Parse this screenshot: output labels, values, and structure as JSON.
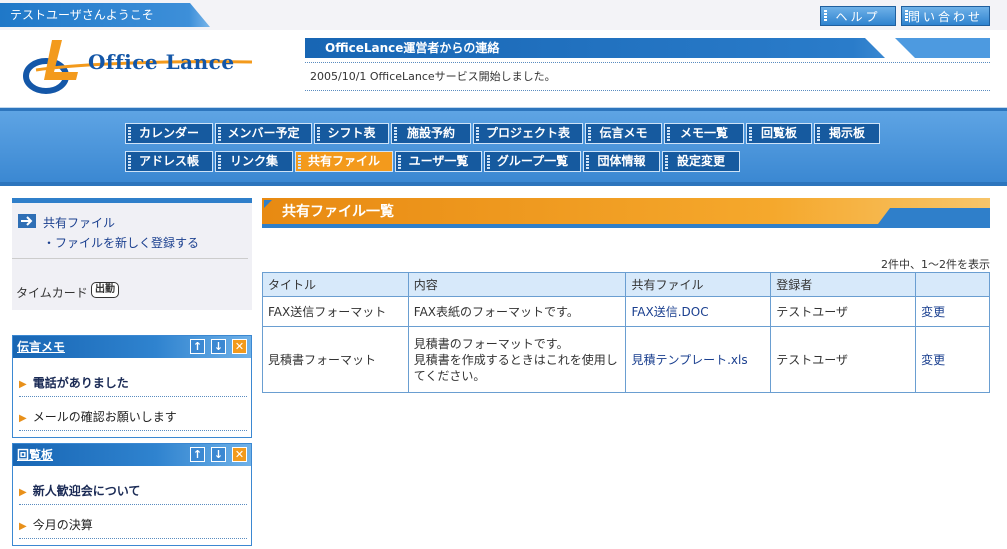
{
  "topbar": {
    "welcome": "テストユーザさんようこそ",
    "help_label": "ヘルプ",
    "contact_label": "問い合わせ"
  },
  "header": {
    "logo_text": "Office Lance",
    "notice_title": "OfficeLance運営者からの連絡",
    "notice_text": "2005/10/1 OfficeLanceサービス開始しました。"
  },
  "nav": {
    "row1": [
      "カレンダー",
      "メンバー予定",
      "シフト表",
      "施設予約",
      "プロジェクト表",
      "伝言メモ",
      "メモ一覧",
      "回覧板",
      "掲示板"
    ],
    "row2": [
      "アドレス帳",
      "リンク集",
      "共有ファイル",
      "ユーザ一覧",
      "グループ一覧",
      "団体情報",
      "設定変更"
    ],
    "active": "共有ファイル"
  },
  "sidebar": {
    "shared_files": "共有ファイル",
    "register_new": "・ファイルを新しく登録する",
    "timecard_label": "タイムカード",
    "punch_label": "出勤"
  },
  "memo_panel": {
    "title": "伝言メモ",
    "items": [
      "電話がありました",
      "メールの確認お願いします"
    ]
  },
  "circular_panel": {
    "title": "回覧板",
    "items": [
      "新人歓迎会について",
      "今月の決算"
    ]
  },
  "main": {
    "title": "共有ファイル一覧",
    "count_text": "2件中、1〜2件を表示",
    "columns": [
      "タイトル",
      "内容",
      "共有ファイル",
      "登録者",
      ""
    ],
    "rows": [
      {
        "title": "FAX送信フォーマット",
        "content": "FAX表紙のフォーマットです。",
        "file": "FAX送信.DOC",
        "owner": "テストユーザ",
        "action": "変更"
      },
      {
        "title": "見積書フォーマット",
        "content": "見積書のフォーマットです。\n見積書を作成するときはこれを使用してください。",
        "file": "見積テンプレート.xls",
        "owner": "テストユーザ",
        "action": "変更"
      }
    ]
  }
}
